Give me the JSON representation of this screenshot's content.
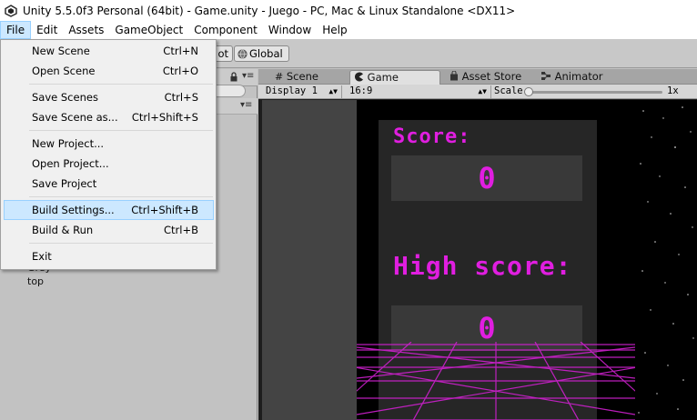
{
  "window": {
    "title": "Unity 5.5.0f3 Personal (64bit) - Game.unity - Juego - PC, Mac & Linux Standalone <DX11>"
  },
  "menubar": {
    "items": [
      "File",
      "Edit",
      "Assets",
      "GameObject",
      "Component",
      "Window",
      "Help"
    ],
    "active": "File"
  },
  "toolbar": {
    "pivot_partial": "ot",
    "global_label": "Global"
  },
  "tabs": [
    {
      "label": "Scene",
      "icon": "hash-icon"
    },
    {
      "label": "Game",
      "icon": "pacman-icon",
      "active": true
    },
    {
      "label": "Asset Store",
      "icon": "bag-icon"
    },
    {
      "label": "Animator",
      "icon": "animator-icon"
    }
  ],
  "game_view": {
    "display": "Display 1",
    "aspect": "16:9",
    "scale_label": "Scale",
    "scale_value": "1x"
  },
  "hierarchy": {
    "items": [
      "Grey",
      "top"
    ]
  },
  "file_menu": {
    "groups": [
      [
        {
          "label": "New Scene",
          "shortcut": "Ctrl+N"
        },
        {
          "label": "Open Scene",
          "shortcut": "Ctrl+O"
        }
      ],
      [
        {
          "label": "Save Scenes",
          "shortcut": "Ctrl+S"
        },
        {
          "label": "Save Scene as...",
          "shortcut": "Ctrl+Shift+S"
        }
      ],
      [
        {
          "label": "New Project...",
          "shortcut": ""
        },
        {
          "label": "Open Project...",
          "shortcut": ""
        },
        {
          "label": "Save Project",
          "shortcut": ""
        }
      ],
      [
        {
          "label": "Build Settings...",
          "shortcut": "Ctrl+Shift+B",
          "highlighted": true
        },
        {
          "label": "Build & Run",
          "shortcut": "Ctrl+B"
        }
      ],
      [
        {
          "label": "Exit",
          "shortcut": ""
        }
      ]
    ]
  },
  "game": {
    "score_label": "Score:",
    "score_value": "0",
    "high_score_label": "High score:",
    "high_score_value": "0",
    "accent_color": "#e01ee0"
  }
}
